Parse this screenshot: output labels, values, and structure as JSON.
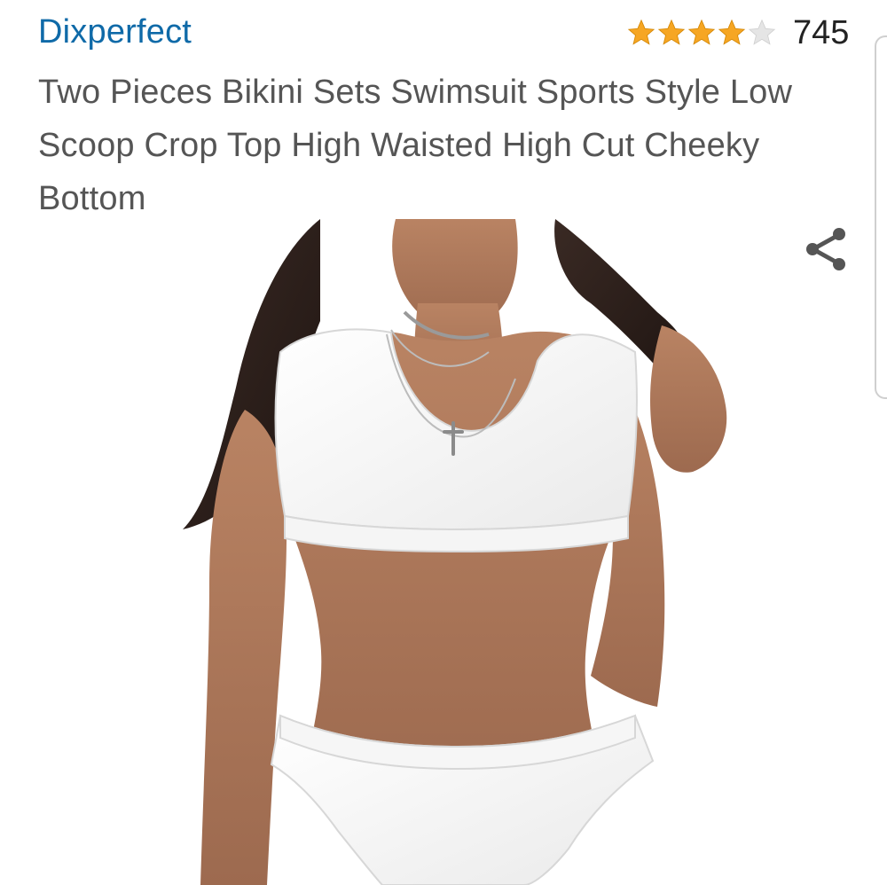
{
  "product": {
    "brand": "Dixperfect",
    "title": "Two Pieces Bikini Sets Swimsuit Sports Style Low Scoop Crop Top High Waisted High Cut Cheeky Bottom",
    "rating": {
      "stars": 4,
      "max_stars": 5,
      "review_count": "745"
    },
    "image": {
      "alt": "Model wearing white sports style bikini set"
    }
  },
  "actions": {
    "share_icon": "share-icon"
  },
  "colors": {
    "brand": "#0f6aa8",
    "title": "#555555",
    "star_filled": "#f6a623",
    "star_empty": "#d9d9d9",
    "icon": "#555555"
  }
}
